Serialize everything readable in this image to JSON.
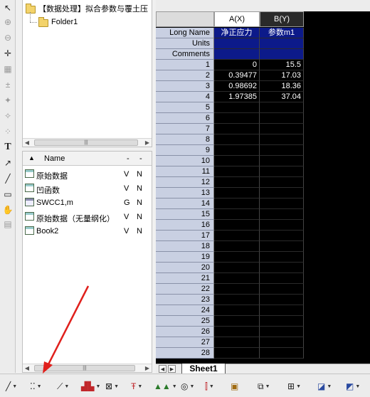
{
  "tree": {
    "root_label": "【数据处理】拟合参数与覆土压",
    "folder_label": "Folder1"
  },
  "file_list": {
    "col_name": "Name",
    "col_extra": "-",
    "items": [
      {
        "name": "原始数据",
        "c1": "V",
        "c2": "N",
        "icon": "workbook-icon"
      },
      {
        "name": "凹函数",
        "c1": "V",
        "c2": "N",
        "icon": "workbook-icon"
      },
      {
        "name": "SWCC1,m",
        "c1": "G",
        "c2": "N",
        "icon": "matrix-icon"
      },
      {
        "name": "原始数据（无量纲化）",
        "c1": "V",
        "c2": "N",
        "icon": "workbook-icon"
      },
      {
        "name": "Book2",
        "c1": "V",
        "c2": "N",
        "icon": "workbook-icon"
      }
    ]
  },
  "worksheet": {
    "columns": [
      "A(X)",
      "B(Y)"
    ],
    "meta_rows": [
      {
        "label": "Long Name",
        "a": "净正应力",
        "b": "参数m1"
      },
      {
        "label": "Units",
        "a": "",
        "b": ""
      },
      {
        "label": "Comments",
        "a": "",
        "b": ""
      }
    ],
    "rows": [
      {
        "n": "1",
        "a": "0",
        "b": "15.5"
      },
      {
        "n": "2",
        "a": "0.39477",
        "b": "17.03"
      },
      {
        "n": "3",
        "a": "0.98692",
        "b": "18.36"
      },
      {
        "n": "4",
        "a": "1.97385",
        "b": "37.04"
      },
      {
        "n": "5",
        "a": "",
        "b": ""
      },
      {
        "n": "6",
        "a": "",
        "b": ""
      },
      {
        "n": "7",
        "a": "",
        "b": ""
      },
      {
        "n": "8",
        "a": "",
        "b": ""
      },
      {
        "n": "9",
        "a": "",
        "b": ""
      },
      {
        "n": "10",
        "a": "",
        "b": ""
      },
      {
        "n": "11",
        "a": "",
        "b": ""
      },
      {
        "n": "12",
        "a": "",
        "b": ""
      },
      {
        "n": "13",
        "a": "",
        "b": ""
      },
      {
        "n": "14",
        "a": "",
        "b": ""
      },
      {
        "n": "15",
        "a": "",
        "b": ""
      },
      {
        "n": "16",
        "a": "",
        "b": ""
      },
      {
        "n": "17",
        "a": "",
        "b": ""
      },
      {
        "n": "18",
        "a": "",
        "b": ""
      },
      {
        "n": "19",
        "a": "",
        "b": ""
      },
      {
        "n": "20",
        "a": "",
        "b": ""
      },
      {
        "n": "21",
        "a": "",
        "b": ""
      },
      {
        "n": "22",
        "a": "",
        "b": ""
      },
      {
        "n": "23",
        "a": "",
        "b": ""
      },
      {
        "n": "24",
        "a": "",
        "b": ""
      },
      {
        "n": "25",
        "a": "",
        "b": ""
      },
      {
        "n": "26",
        "a": "",
        "b": ""
      },
      {
        "n": "27",
        "a": "",
        "b": ""
      },
      {
        "n": "28",
        "a": "",
        "b": ""
      }
    ],
    "sheet_tab": "Sheet1"
  },
  "left_tools": [
    "pointer-icon",
    "zoom-in-icon",
    "zoom-out-icon",
    "crosshair-icon",
    "scale-icon",
    "data-reader-icon",
    "screen-reader-icon",
    "mask-icon",
    "region-icon",
    "text-tool-icon",
    "arrow-tool-icon",
    "line-tool-icon",
    "rectangle-tool-icon",
    "hand-icon",
    "draw-data-icon"
  ],
  "bottom_tools": [
    "line-plot-icon",
    "scatter-plot-icon",
    "line-symbol-plot-icon",
    "column-plot-icon",
    "plot-3d-icon",
    "error-bar-plot-icon",
    "area-plot-icon",
    "polar-plot-icon",
    "box-chart-icon",
    "template-icon",
    "layer-icon",
    "merge-icon",
    "export-icon"
  ],
  "colors": {
    "meta_bg": "#0c1a8a",
    "data_bg": "#000000",
    "rowlabel_bg": "#c9d0e2",
    "annotation_arrow": "#e0201c"
  }
}
